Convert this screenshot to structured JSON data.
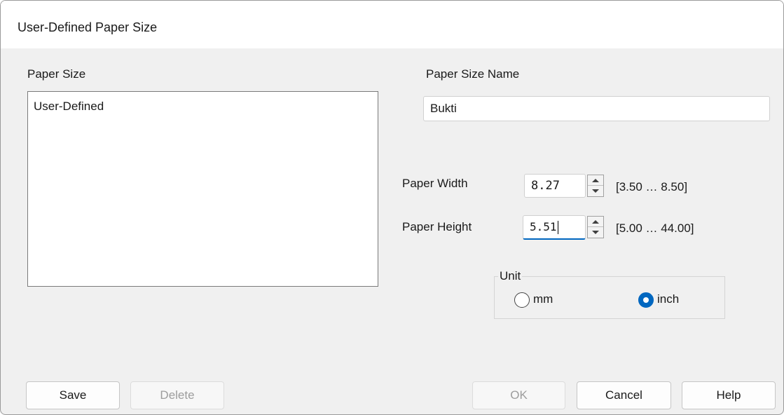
{
  "window": {
    "title": "User-Defined Paper Size"
  },
  "paper_size": {
    "label": "Paper Size",
    "items": [
      "User-Defined"
    ]
  },
  "paper_size_name": {
    "label": "Paper Size Name",
    "value": "Bukti"
  },
  "paper_width": {
    "label": "Paper Width",
    "value": "8.27",
    "range": "[3.50 … 8.50]"
  },
  "paper_height": {
    "label": "Paper Height",
    "value": "5.51",
    "range": "[5.00 … 44.00]"
  },
  "unit": {
    "label": "Unit",
    "options": [
      {
        "label": "mm",
        "checked": false
      },
      {
        "label": "inch",
        "checked": true
      }
    ]
  },
  "buttons": {
    "save": "Save",
    "delete": "Delete",
    "ok": "OK",
    "cancel": "Cancel",
    "help": "Help"
  },
  "colors": {
    "accent": "#0067c0",
    "dialog_background": "#f0f0f0",
    "disabled_text": "#9d9d9d"
  }
}
